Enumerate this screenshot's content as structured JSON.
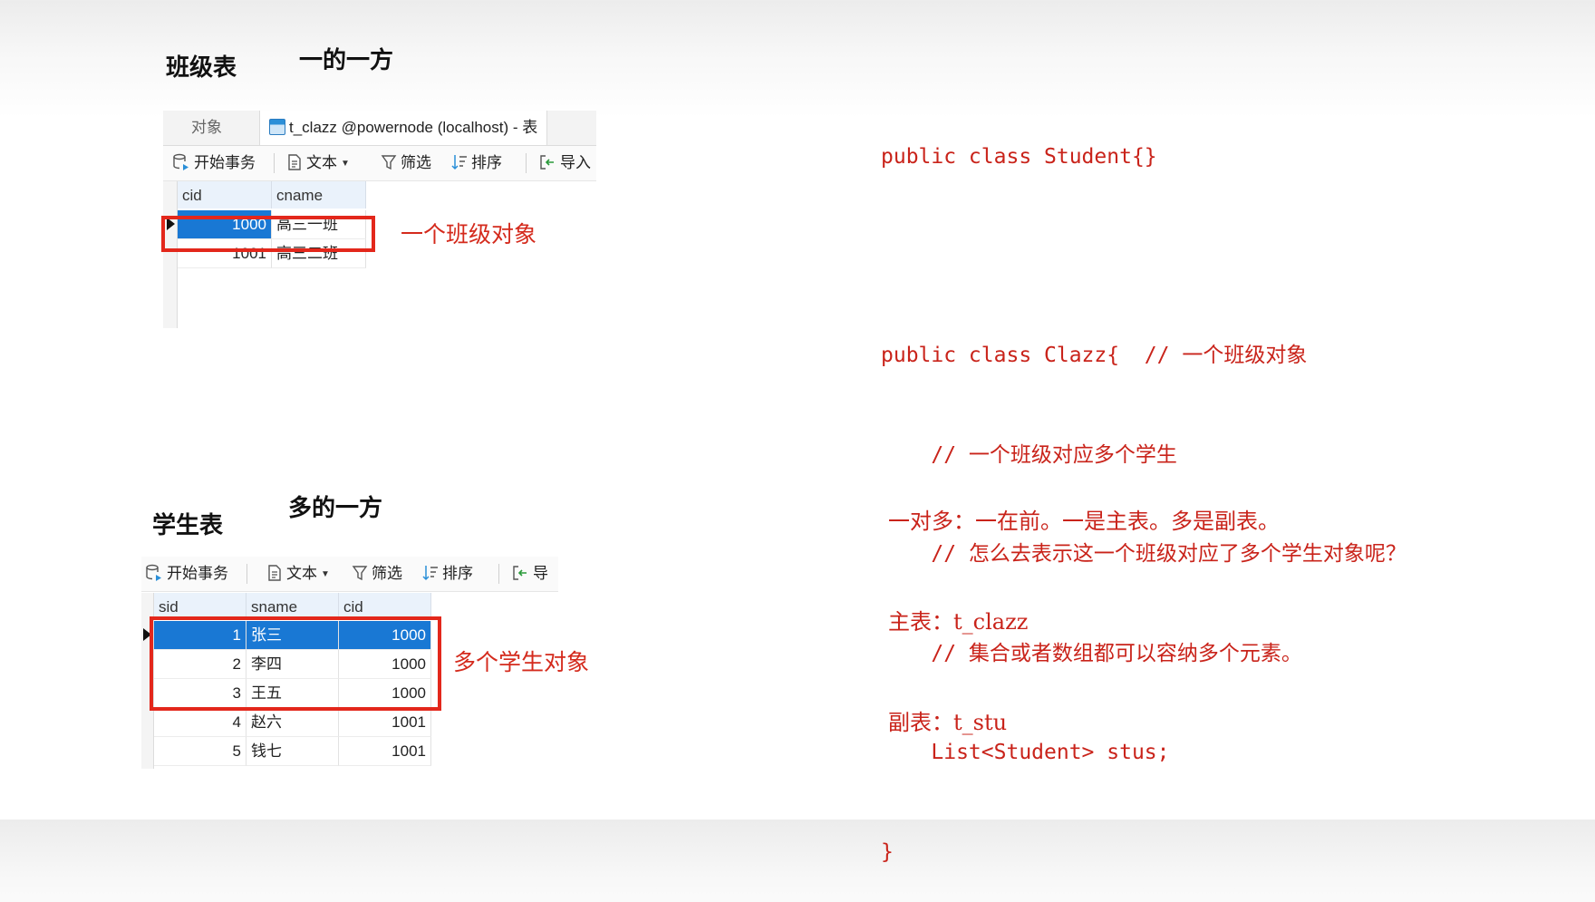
{
  "top": {
    "heading": "班级表",
    "subheading": "一的一方",
    "tabs": {
      "objects": "对象",
      "table": "t_clazz @powernode (localhost) - 表"
    },
    "toolbar": {
      "begin_tx": "开始事务",
      "text": "文本",
      "filter": "筛选",
      "sort": "排序",
      "import": "导入"
    },
    "columns": [
      "cid",
      "cname"
    ],
    "rows": [
      {
        "cid": "1000",
        "cname": "高三一班"
      },
      {
        "cid": "1001",
        "cname": "高三二班"
      }
    ],
    "annotation": "一个班级对象"
  },
  "bottom": {
    "heading": "学生表",
    "subheading": "多的一方",
    "toolbar": {
      "begin_tx": "开始事务",
      "text": "文本",
      "filter": "筛选",
      "sort": "排序",
      "import": "导"
    },
    "columns": [
      "sid",
      "sname",
      "cid"
    ],
    "rows": [
      {
        "sid": "1",
        "sname": "张三",
        "cid": "1000"
      },
      {
        "sid": "2",
        "sname": "李四",
        "cid": "1000"
      },
      {
        "sid": "3",
        "sname": "王五",
        "cid": "1000"
      },
      {
        "sid": "4",
        "sname": "赵六",
        "cid": "1001"
      },
      {
        "sid": "5",
        "sname": "钱七",
        "cid": "1001"
      }
    ],
    "annotation": "多个学生对象"
  },
  "code": {
    "lines": [
      "public class Student{}",
      "",
      "public class Clazz{  // 一个班级对象",
      "    // 一个班级对应多个学生",
      "    // 怎么去表示这一个班级对应了多个学生对象呢？",
      "    // 集合或者数组都可以容纳多个元素。",
      "    List<Student> stus;",
      "}"
    ]
  },
  "notes": {
    "lines": [
      "一对多：一在前。一是主表。多是副表。",
      "主表：t_clazz",
      "副表：t_stu"
    ]
  },
  "colors": {
    "annotation_red": "#d42a1c",
    "selection_blue": "#1978d4",
    "highlight_box": "#e3271b"
  }
}
